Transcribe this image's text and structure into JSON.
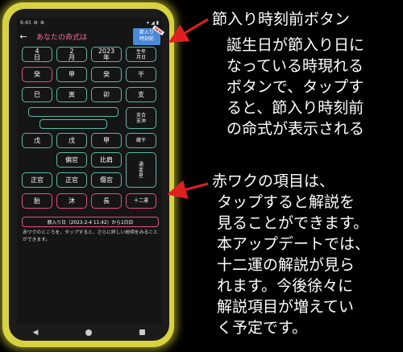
{
  "status": {
    "time": "6:43"
  },
  "appbar": {
    "title": "あなたの命式は",
    "setsu_button": [
      "節入り",
      "時刻前"
    ],
    "ribbon": "NEW"
  },
  "grid": {
    "row_date": [
      "4\n日",
      "2\n月",
      "2023\n年",
      "生年\n月日"
    ],
    "row_kan": [
      "癸",
      "甲",
      "癸",
      "干"
    ],
    "row_shi": [
      "巳",
      "寅",
      "卯",
      "支"
    ],
    "gochu": "支合\n支沖",
    "row_zokan": [
      "戊",
      "戊",
      "甲",
      "蔵干"
    ],
    "row_tsuhen1": [
      "",
      "偏官",
      "比肩",
      "通\n変\n星"
    ],
    "row_tsuhen2": [
      "正官",
      "正官",
      "傷官"
    ],
    "row_twelve": [
      "胎",
      "沐",
      "長",
      "十二運"
    ]
  },
  "jump_bar": "節入り日（2023-2-4 11:42）から1日目",
  "note": "赤ワクのところを、タップすると、さらに詳しい説明をみることができます。",
  "annotations": {
    "a1": "節入り時刻前ボタン",
    "a2": [
      "誕生日が節入り日に",
      "なっている時現れる",
      "ボタンで、タップす",
      "ると、節入り時刻前",
      "の命式が表示される"
    ],
    "a3": [
      "赤ワクの項目は、",
      "タップすると解説を",
      "見ることができます。",
      "本アップデートでは、",
      "十二運の解説が見ら",
      "れます。今後徐々に",
      "解説項目が増えてい",
      "く予定です。"
    ]
  },
  "colors": {
    "pink": "#e94b86",
    "teal": "#5bb7a7",
    "blue": "#4a88d8",
    "arrow": "#e02020",
    "glow": "#d8d240"
  }
}
